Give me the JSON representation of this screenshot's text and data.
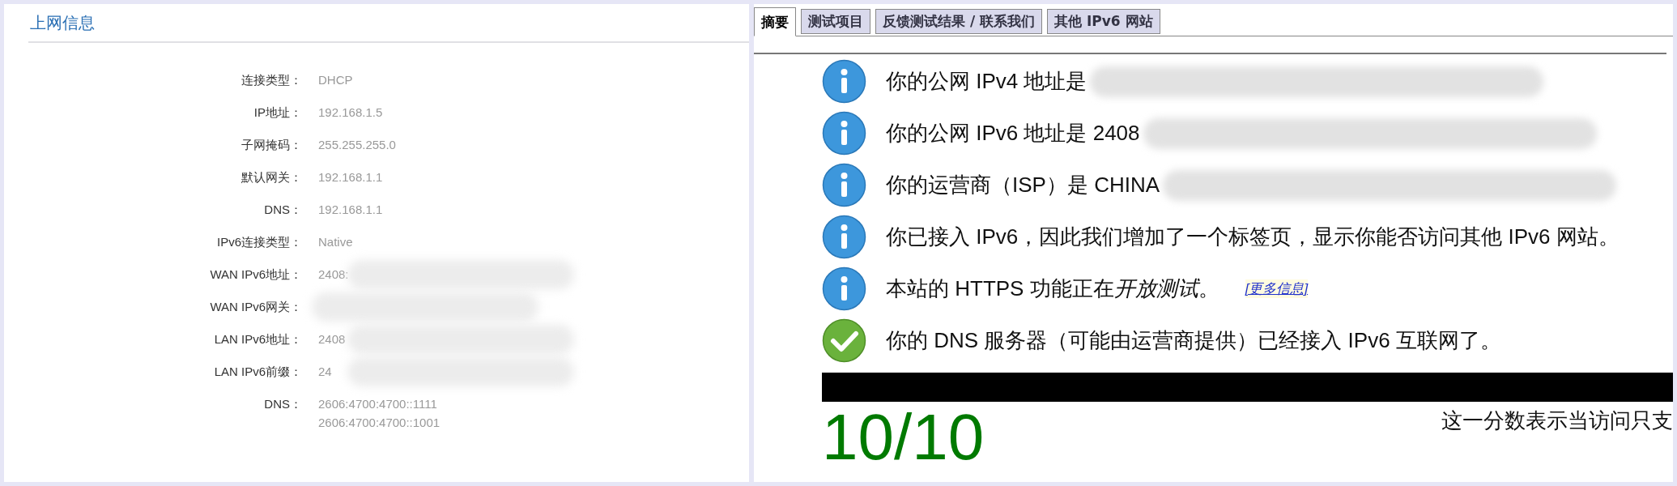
{
  "left": {
    "title": "上网信息",
    "rows": [
      {
        "label": "连接类型：",
        "values": [
          "DHCP"
        ],
        "redacted": false
      },
      {
        "label": "IP地址：",
        "values": [
          "192.168.1.5"
        ],
        "redacted": false
      },
      {
        "label": "子网掩码：",
        "values": [
          "255.255.255.0"
        ],
        "redacted": false
      },
      {
        "label": "默认网关：",
        "values": [
          "192.168.1.1"
        ],
        "redacted": false
      },
      {
        "label": "DNS：",
        "values": [
          "192.168.1.1"
        ],
        "redacted": false
      },
      {
        "label": "IPv6连接类型：",
        "values": [
          "Native"
        ],
        "redacted": false
      },
      {
        "label": "WAN IPv6地址：",
        "values": [
          "2408:"
        ],
        "redacted": true
      },
      {
        "label": "WAN IPv6网关：",
        "values": [],
        "redacted": true
      },
      {
        "label": "LAN IPv6地址：",
        "values": [
          "2408"
        ],
        "redacted": true
      },
      {
        "label": "LAN IPv6前缀：",
        "values": [
          "24"
        ],
        "redacted": true
      },
      {
        "label": "DNS：",
        "values": [
          "2606:4700:4700::1111",
          "2606:4700:4700::1001"
        ],
        "redacted": false
      }
    ]
  },
  "right": {
    "tabs": [
      {
        "label": "摘要",
        "selected": true
      },
      {
        "label": "测试项目",
        "selected": false
      },
      {
        "label": "反馈测试结果 / 联系我们",
        "selected": false
      },
      {
        "label": "其他 IPv6 网站",
        "selected": false
      }
    ],
    "messages": [
      {
        "kind": "info",
        "text": "你的公网 IPv4 地址是",
        "redacted": true
      },
      {
        "kind": "info",
        "text": "你的公网 IPv6 地址是 2408",
        "redacted": true
      },
      {
        "kind": "info",
        "text": "你的运营商（ISP）是 CHINA",
        "redacted": true
      },
      {
        "kind": "info",
        "text": "你已接入 IPv6，因此我们增加了一个标签页，显示你能否访问其他 IPv6 网站。",
        "redacted": false
      },
      {
        "kind": "info",
        "text": "本站的 HTTPS 功能正在",
        "emphasis": "开放测试",
        "tail": "。",
        "link": "[更多信息]",
        "redacted": false
      },
      {
        "kind": "ok",
        "text": "你的 DNS 服务器（可能由运营商提供）已经接入 IPv6 互联网了。",
        "redacted": false
      }
    ],
    "score": "10/10",
    "score_note": "这一分数表示当访问只支"
  }
}
